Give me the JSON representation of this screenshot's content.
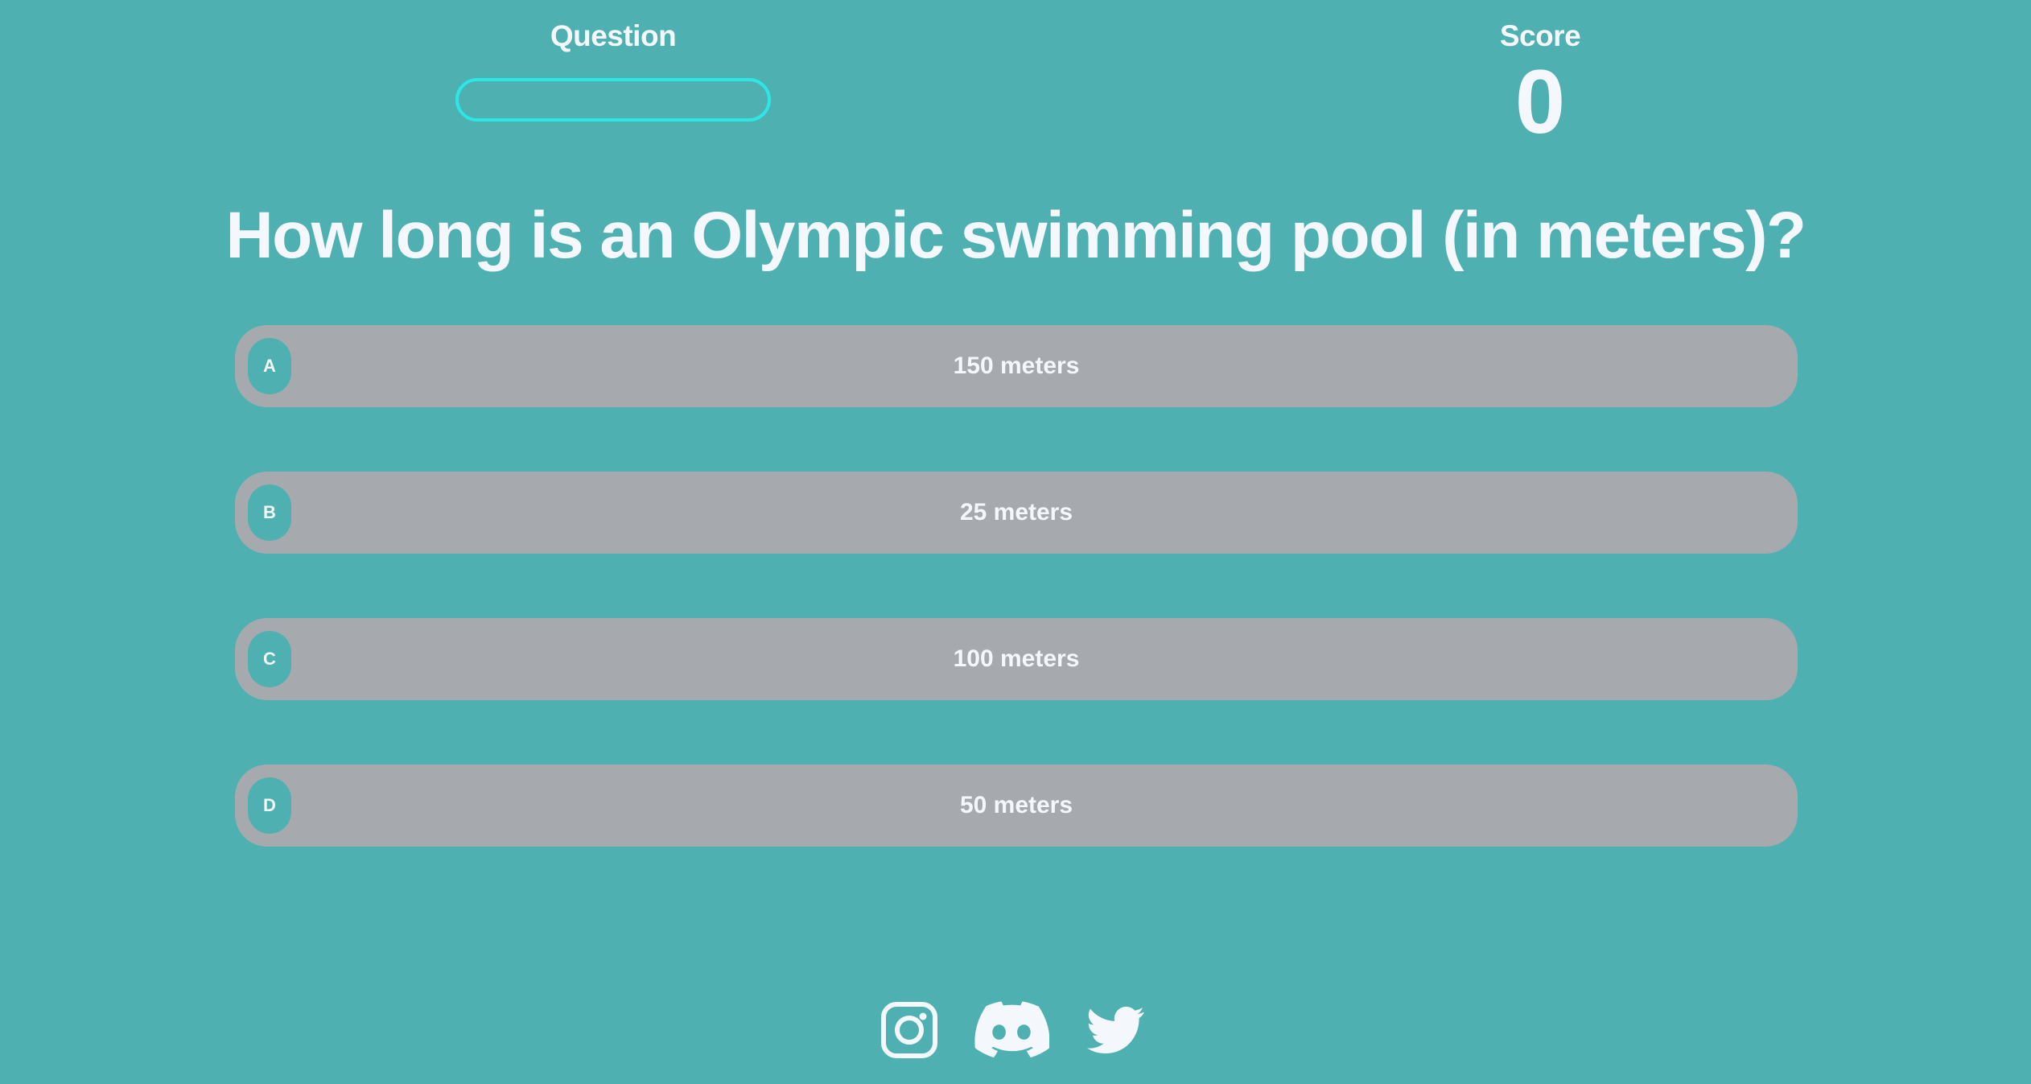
{
  "hud": {
    "question_label": "Question",
    "progress_fraction": 0,
    "score_label": "Score",
    "score_value": "0"
  },
  "question": {
    "text": "How long is an Olympic swimming pool (in meters)?"
  },
  "answers": [
    {
      "letter": "A",
      "text": "150 meters"
    },
    {
      "letter": "B",
      "text": "25 meters"
    },
    {
      "letter": "C",
      "text": "100 meters"
    },
    {
      "letter": "D",
      "text": "50 meters"
    }
  ],
  "footer": {
    "icons": [
      "instagram-icon",
      "discord-icon",
      "twitter-icon"
    ]
  },
  "colors": {
    "background": "#4FB0B1",
    "answer_background": "#A6AAAF",
    "progress_border": "#2EE6E6",
    "text": "#F4F8FC"
  }
}
